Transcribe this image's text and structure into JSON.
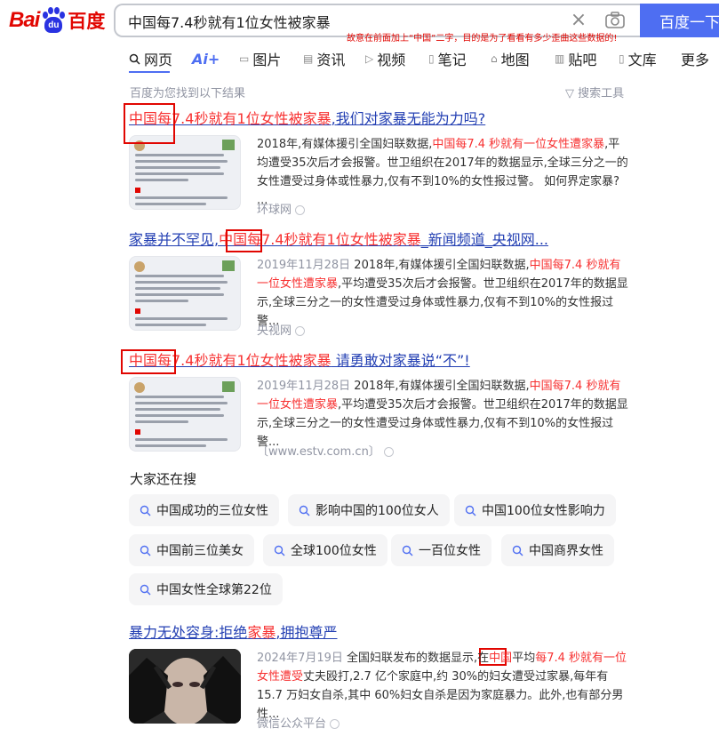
{
  "logo": {
    "bai": "Bai",
    "du": "du",
    "baidu_cn": "百度"
  },
  "search": {
    "query": "中国每7.4秒就有1位女性被家暴",
    "button_label": "百度一下"
  },
  "annotation_note": "故意在前面加上“中国”二字，目的是为了看看有多少歪曲这些数据的!",
  "tabs": [
    {
      "label": "网页",
      "icon": "search-icon"
    },
    {
      "label": "Ai+",
      "icon": "ai-icon"
    },
    {
      "label": "图片",
      "icon": "image-icon"
    },
    {
      "label": "资讯",
      "icon": "news-icon"
    },
    {
      "label": "视频",
      "icon": "video-icon"
    },
    {
      "label": "笔记",
      "icon": "note-icon"
    },
    {
      "label": "地图",
      "icon": "map-icon"
    },
    {
      "label": "贴吧",
      "icon": "tieba-icon"
    },
    {
      "label": "文库",
      "icon": "doc-icon"
    },
    {
      "label": "更多",
      "icon": ""
    }
  ],
  "found_text": "百度为您找到以下结果",
  "tools_text": "搜索工具",
  "results": [
    {
      "title_em": "中国每7.4秒就有1位女性被家暴",
      "title_rest": ",我们对家暴无能为力吗?",
      "abs_pre": "2018年,有媒体援引全国妇联数据,",
      "abs_em": "中国每7.4 秒就有一位女性遭家暴",
      "abs_post": ",平均遭受35次后才会报警。世卫组织在2017年的数据显示,全球三分之一的女性遭受过身体或性暴力,仅有不到10%的女性报过警。 如何界定家暴? ...",
      "date": "",
      "source": "环球网"
    },
    {
      "title_pre": "家暴并不罕见,",
      "title_em": "中国每7.4秒就有1位女性被家暴",
      "title_rest": "_新闻频道_央视网...",
      "date": "2019年11月28日",
      "abs_pre": " 2018年,有媒体援引全国妇联数据,",
      "abs_em": "中国每7.4 秒就有一位女性遭家暴",
      "abs_post": ",平均遭受35次后才会报警。世卫组织在2017年的数据显示,全球三分之一的女性遭受过身体或性暴力,仅有不到10%的女性报过警...",
      "source": "央视网"
    },
    {
      "title_em": "中国每7.4秒就有1位女性被家暴",
      "title_rest": " 请勇敢对家暴说“不”!",
      "date": "2019年11月28日",
      "abs_pre": " 2018年,有媒体援引全国妇联数据,",
      "abs_em": "中国每7.4 秒就有一位女性遭家暴",
      "abs_post": ",平均遭受35次后才会报警。世卫组织在2017年的数据显示,全球三分之一的女性遭受过身体或性暴力,仅有不到10%的女性报过警...",
      "source": "〔www.estv.com.cn〕"
    },
    {
      "title_pre": "暴力无处容身:拒绝",
      "title_em": "家暴",
      "title_rest": ",拥抱尊严",
      "date": "2024年7月19日",
      "abs_pre": " 全国妇联发布的数据显示,在",
      "abs_em_a": "中国",
      "abs_mid": "平均",
      "abs_em": "每7.4 秒就有一位女性遭受",
      "abs_post": "丈夫殴打,2.7 亿个家庭中,约 30%的妇女遭受过家暴,每年有 15.7 万妇女自杀,其中 60%妇女自杀是因为家庭暴力。此外,也有部分男性...",
      "source": "微信公众平台"
    }
  ],
  "related": {
    "title": "大家还在搜",
    "items": [
      "中国成功的三位女性",
      "影响中国的100位女人",
      "中国100位女性影响力",
      "中国前三位美女",
      "全球100位女性",
      "一百位女性",
      "中国商界女性",
      "中国女性全球第22位"
    ]
  },
  "colors": {
    "link": "#2440b3",
    "highlight": "#f73131",
    "brand_blue": "#4e6ef2",
    "annotation_red": "#e10601"
  }
}
